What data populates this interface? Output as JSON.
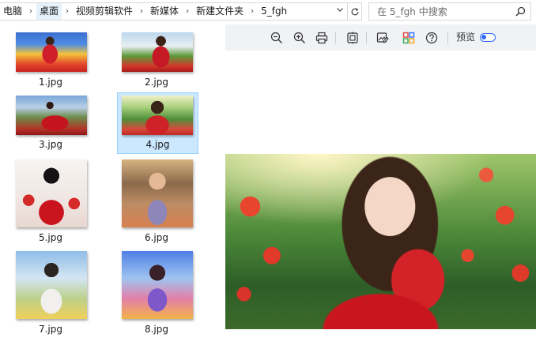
{
  "address_bar": {
    "breadcrumbs": [
      "电脑",
      "桌面",
      "视频剪辑软件",
      "新媒体",
      "新建文件夹",
      "5_fgh"
    ],
    "current_index": 1
  },
  "search": {
    "placeholder": "在 5_fgh 中搜索"
  },
  "files": [
    {
      "name": "1.jpg",
      "selected": false
    },
    {
      "name": "2.jpg",
      "selected": false
    },
    {
      "name": "3.jpg",
      "selected": false
    },
    {
      "name": "4.jpg",
      "selected": true
    },
    {
      "name": "5.jpg",
      "selected": false
    },
    {
      "name": "6.jpg",
      "selected": false
    },
    {
      "name": "7.jpg",
      "selected": false
    },
    {
      "name": "8.jpg",
      "selected": false
    }
  ],
  "preview_toolbar": {
    "buttons": [
      "zoom-out-icon",
      "zoom-in-icon",
      "print-icon",
      "crop-icon",
      "edit-image-icon",
      "app-grid-icon",
      "help-icon"
    ],
    "preview_label": "预览",
    "preview_toggle_on": true
  },
  "colors": {
    "accent": "#2f6bff",
    "selection_bg": "#cce8ff",
    "selection_border": "#99d1ff",
    "toolbar_bg": "#f0f2f5"
  }
}
